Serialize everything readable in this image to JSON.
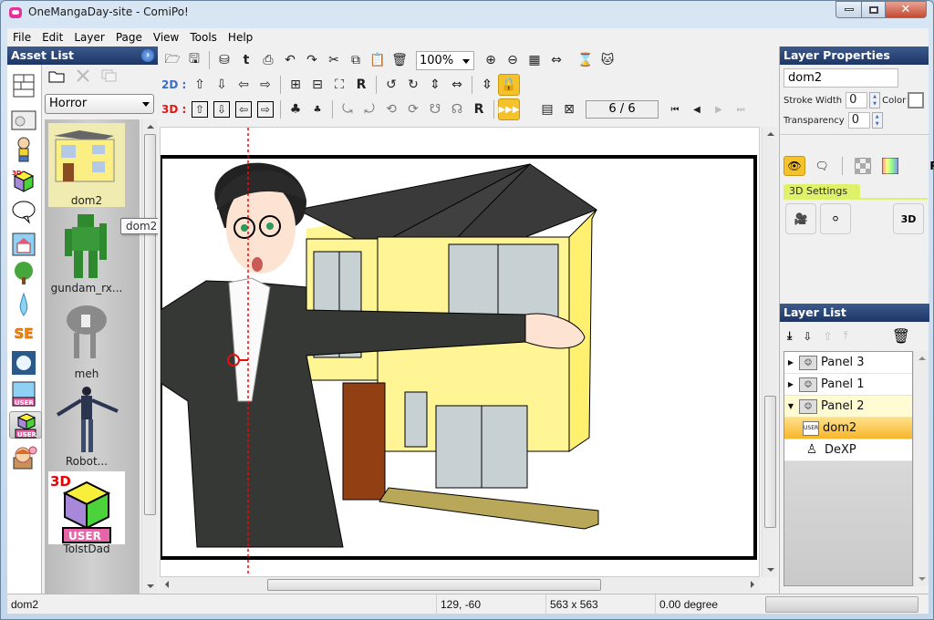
{
  "window": {
    "title": "OneMangaDay-site - ComiPo!",
    "controls": {
      "minimize": "—",
      "maximize": "▭",
      "close": "✕"
    }
  },
  "menu": [
    "File",
    "Edit",
    "Layer",
    "Page",
    "View",
    "Tools",
    "Help"
  ],
  "asset_panel": {
    "title": "Asset List",
    "category_filter": "Horror",
    "tooltip": "dom2",
    "categories": [
      "panel-layout-icon",
      "background-photo-icon",
      "character-icon",
      "3d-object-icon",
      "speech-balloon-icon",
      "background-icon",
      "tree-icon",
      "drop-effect-icon",
      "sound-effect-icon",
      "flash-effect-icon",
      "user-background-icon",
      "user-3d-icon",
      "user-character-icon"
    ],
    "tools": [
      "open-folder-icon",
      "delete-icon",
      "copy-to-icon"
    ],
    "items": [
      {
        "label": "dom2",
        "selected": true
      },
      {
        "label": "gundam_rx..."
      },
      {
        "label": "meh"
      },
      {
        "label": "Robot..."
      },
      {
        "label": "TolstDad"
      }
    ],
    "thumb_badge_3d": "3D",
    "thumb_badge_user": "USER"
  },
  "toolbar": {
    "zoom": "100%",
    "label_2d": "2D :",
    "label_3d": "3D :",
    "page_indicator": "6 / 6",
    "reset_label": "R"
  },
  "layer_properties": {
    "title": "Layer Properties",
    "name": "dom2",
    "stroke_width_label": "Stroke Width",
    "stroke_width": "0",
    "color_label": "Color",
    "transparency_label": "Transparency",
    "transparency": "0",
    "settings_tab": "3D Settings",
    "reset_label": "R"
  },
  "layer_list": {
    "title": "Layer List",
    "nodes": [
      {
        "label": "Panel 3",
        "expanded": false
      },
      {
        "label": "Panel 1",
        "expanded": false
      },
      {
        "label": "Panel 2",
        "expanded": true
      },
      {
        "label": "dom2",
        "selected": true,
        "child": true
      },
      {
        "label": "DeXP",
        "child": true
      }
    ]
  },
  "status": {
    "object": "dom2",
    "position": "129, -60",
    "size": "563 x 563",
    "rotation": "0.00 degree"
  }
}
